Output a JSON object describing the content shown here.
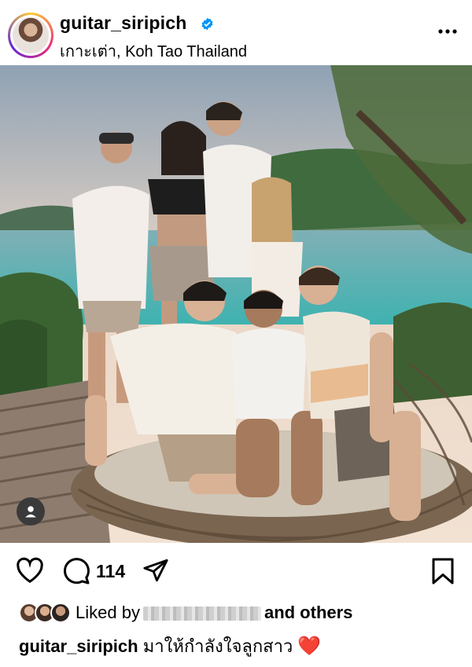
{
  "post": {
    "username": "guitar_siripich",
    "location": "เกาะเต่า, Koh Tao Thailand",
    "comment_count": "114",
    "liked_prefix": "Liked by",
    "liked_suffix": "and others",
    "caption_user": "guitar_siripich",
    "caption_text": "มาให้กำลังใจลูกสาว",
    "caption_emoji": "❤️"
  },
  "icons": {
    "verified": "verified-badge-icon",
    "more": "more-options-icon",
    "like": "heart-icon",
    "comment": "comment-icon",
    "share": "share-icon",
    "save": "bookmark-icon",
    "tag": "user-tag-icon"
  },
  "colors": {
    "verified": "#0095f6",
    "heart": "#e0202b"
  }
}
